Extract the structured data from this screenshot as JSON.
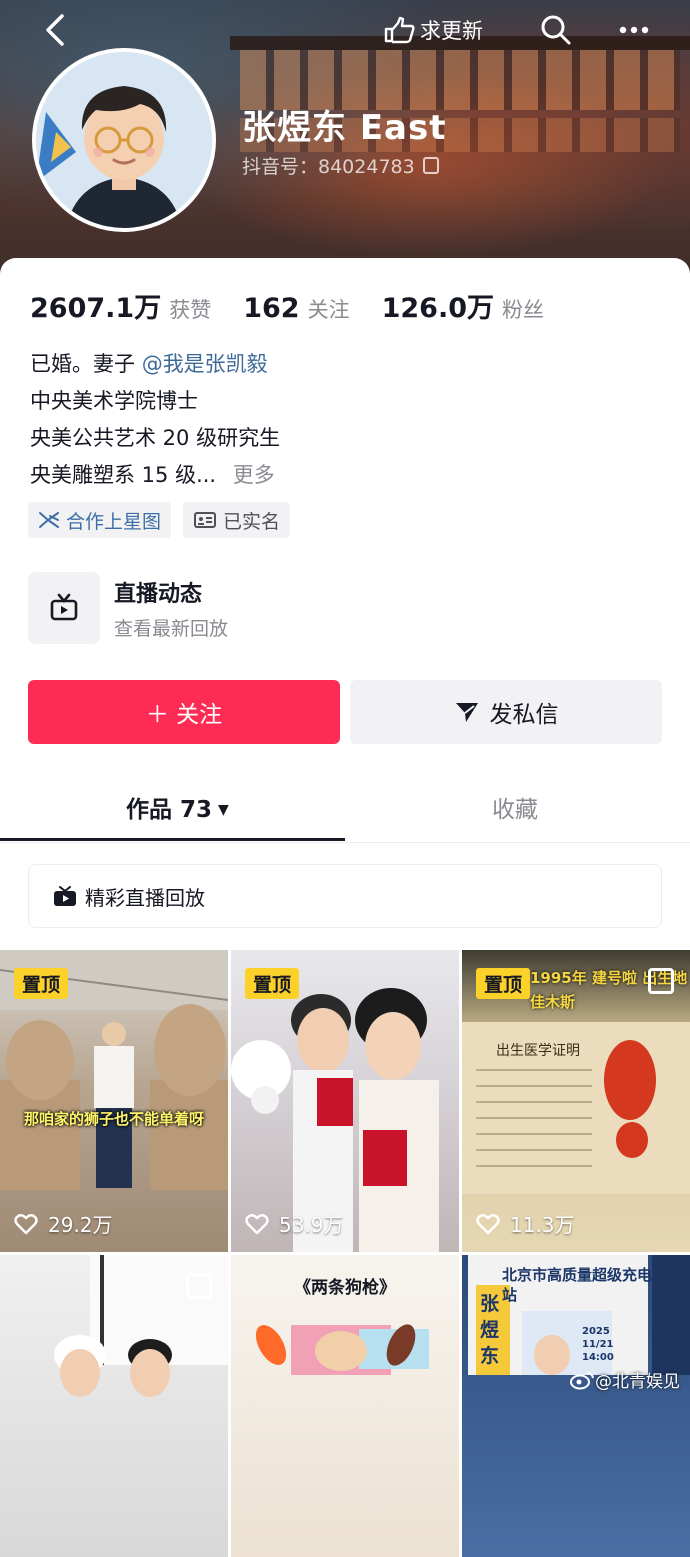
{
  "header": {
    "back_icon": "chevron-left-icon",
    "update_label": "求更新",
    "search_icon": "search-icon",
    "more_icon": "more-icon"
  },
  "profile": {
    "name": "张煜东 East",
    "douyin_id": "抖音号：84024783",
    "stats": [
      {
        "value": "2607.1万",
        "label": "获赞"
      },
      {
        "value": "162",
        "label": "关注"
      },
      {
        "value": "126.0万",
        "label": "粉丝"
      }
    ],
    "bio": {
      "line1_prefix": "已婚。妻子",
      "line1_mention": "@我是张凯毅",
      "line2": "中央美术学院博士",
      "line3": "央美公共艺术 20 级研究生",
      "line4": "央美雕塑系 15 级...",
      "more": "更多"
    },
    "tags": [
      {
        "label": "合作上星图",
        "color": "#3d6fa6"
      },
      {
        "label": "已实名",
        "color": "#505158"
      }
    ]
  },
  "live": {
    "title": "直播动态",
    "subtitle": "查看最新回放"
  },
  "actions": {
    "follow": "＋ 关注",
    "message": "发私信",
    "follow_color": "#fe2c55"
  },
  "tabs": {
    "works": "作品 73",
    "favorites": "收藏"
  },
  "replay_label": "精彩直播回放",
  "grid": {
    "pin_label": "置顶",
    "items": [
      {
        "likes": "29.2万",
        "pinned": true,
        "caption": "那咱家的狮子也不能单着呀"
      },
      {
        "likes": "53.9万",
        "pinned": true
      },
      {
        "likes": "11.3万",
        "pinned": true,
        "title": "1995年 建号啦 出生地 佳木斯",
        "doc_title": "出生医学证明"
      },
      {
        "likes": "",
        "pinned": false
      },
      {
        "likes": "",
        "pinned": false,
        "title": "《两条狗枪》"
      },
      {
        "likes": "",
        "pinned": false,
        "title": "北京市高质量超级充电站",
        "side_text": "张煜东",
        "date": "2025 11/21 14:00"
      }
    ]
  },
  "watermark": "@北青娱见"
}
